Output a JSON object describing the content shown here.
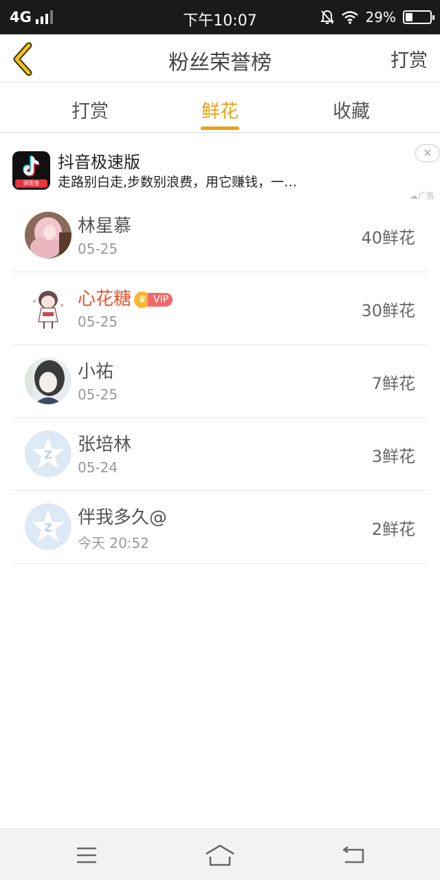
{
  "status_bar": {
    "network": "4G",
    "time": "下午10:07",
    "battery": "29%",
    "battery_level": 0.29,
    "icons": [
      "signal-icon",
      "mute-icon",
      "wifi-icon",
      "battery-icon"
    ]
  },
  "header": {
    "title": "粉丝荣誉榜",
    "action_label": "打赏",
    "back_icon": "chevron-left-icon"
  },
  "tabs": [
    {
      "label": "打赏",
      "active": false
    },
    {
      "label": "鲜花",
      "active": true
    },
    {
      "label": "收藏",
      "active": false
    }
  ],
  "colors": {
    "accent": "#e8a21a",
    "vip_name": "#e5552e",
    "status_bar": "#1a1a1a"
  },
  "ad": {
    "title": "抖音极速版",
    "description": "走路别白走,步数别浪费，用它赚钱，一…",
    "icon_strip": "领现金",
    "label": "广告",
    "close_glyph": "✕"
  },
  "list": [
    {
      "name": "林星慕",
      "date": "05-25",
      "count": "40鲜花",
      "vip": false
    },
    {
      "name": "心花糖",
      "date": "05-25",
      "count": "30鲜花",
      "vip": true,
      "vip_text": "VIP"
    },
    {
      "name": "小祐",
      "date": "05-25",
      "count": "7鲜花",
      "vip": false
    },
    {
      "name": "张培林",
      "date": "05-24",
      "count": "3鲜花",
      "vip": false
    },
    {
      "name": "伴我多久@",
      "date": "今天 20:52",
      "count": "2鲜花",
      "vip": false
    }
  ],
  "bottom_nav": [
    "menu-icon",
    "home-icon",
    "back-icon"
  ]
}
